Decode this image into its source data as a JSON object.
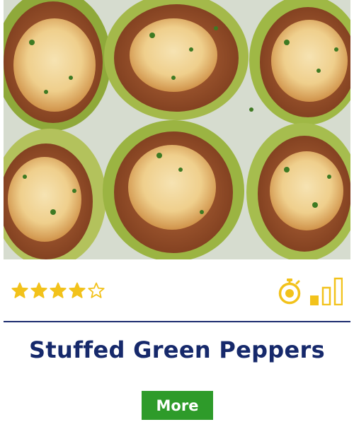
{
  "recipe_card": {
    "image_subject": "stuffed-green-peppers-photo",
    "rating": {
      "value": 4,
      "max": 5,
      "color": "#f2c21b"
    },
    "time_icon": "stopwatch-icon",
    "difficulty_icon": "difficulty-bars-icon",
    "difficulty_level": 1,
    "difficulty_max": 3,
    "accent_color": "#f2c21b",
    "title": "Stuffed Green Peppers",
    "title_color": "#16296b",
    "button": {
      "label": "More",
      "color": "#2e9b2a"
    }
  }
}
